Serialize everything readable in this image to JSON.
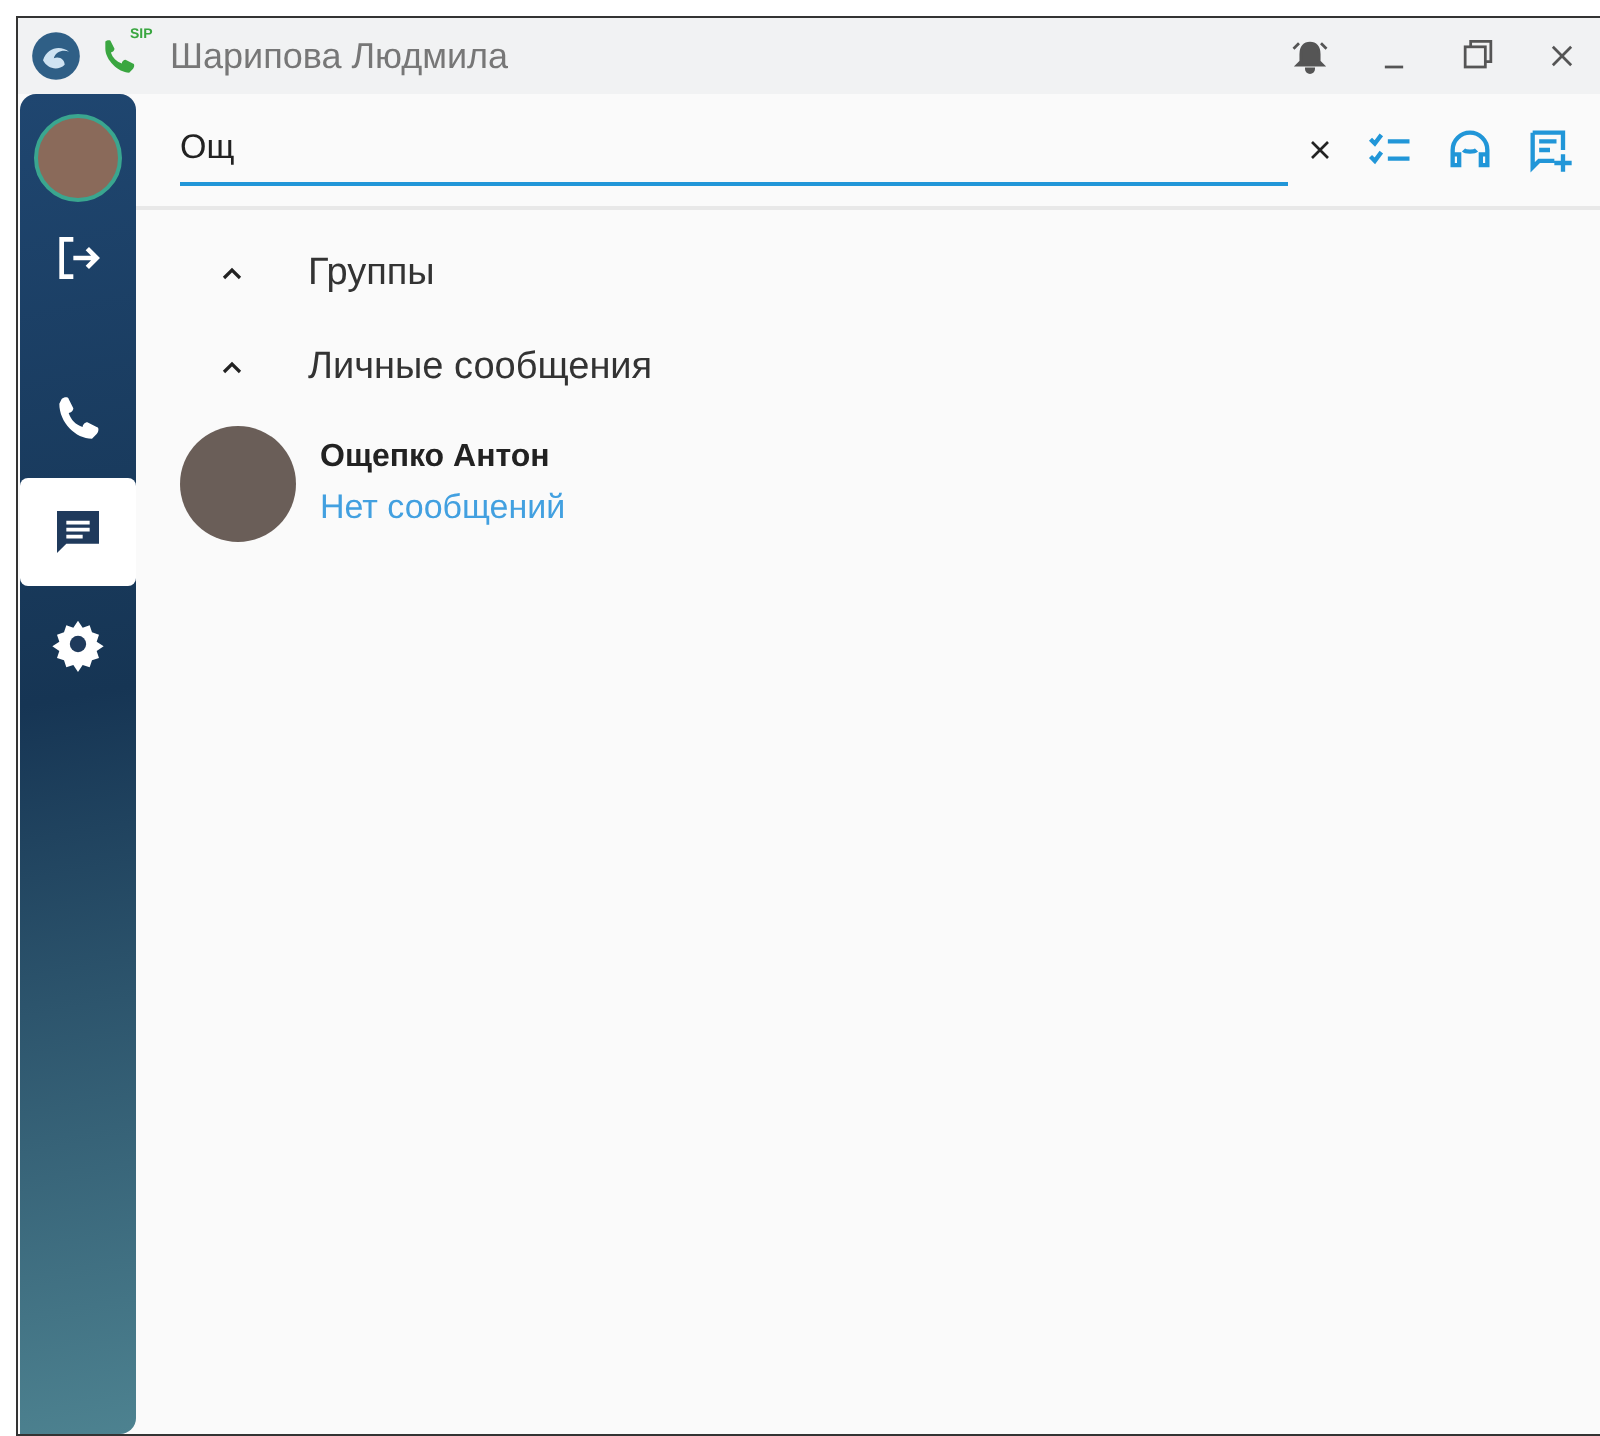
{
  "window": {
    "title": "Шарипова Людмила",
    "sip_label": "SIP"
  },
  "sidebar": {
    "items": [
      {
        "kind": "phone",
        "selected": false
      },
      {
        "kind": "chat",
        "selected": true
      },
      {
        "kind": "settings",
        "selected": false
      }
    ]
  },
  "search": {
    "value": "Ощ"
  },
  "sections": [
    {
      "label": "Группы",
      "expanded": true
    },
    {
      "label": "Личные сообщения",
      "expanded": true
    }
  ],
  "contacts": [
    {
      "name": "Ощепко Антон",
      "status": "Нет сообщений"
    }
  ]
}
